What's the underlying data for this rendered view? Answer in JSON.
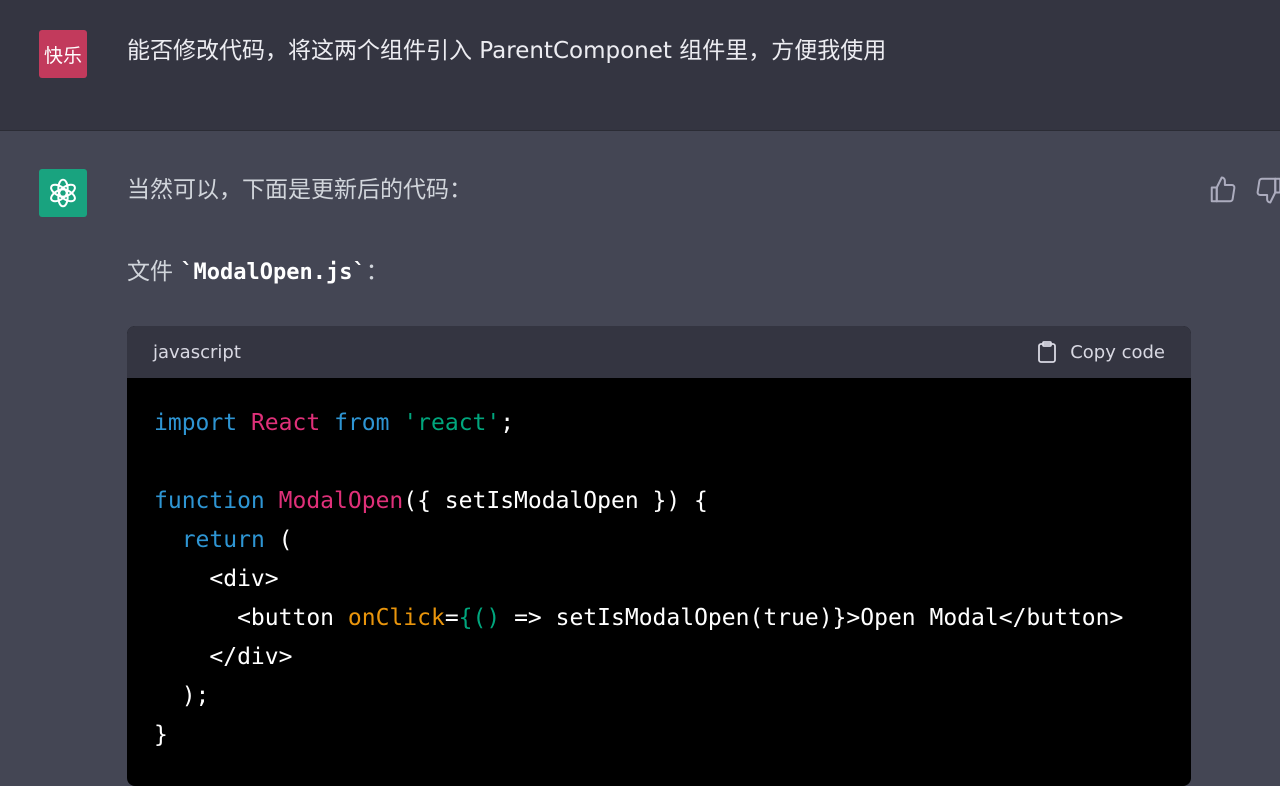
{
  "user_message": {
    "avatar_text": "快乐",
    "text": "能否修改代码，将这两个组件引入 ParentComponet  组件里，方便我使用"
  },
  "assistant_message": {
    "intro": "当然可以，下面是更新后的代码：",
    "file_label_prefix": "文件 ",
    "file_name": "`ModalOpen.js`",
    "file_label_suffix": "：",
    "code_block": {
      "language": "javascript",
      "copy_label": "Copy code",
      "lines": [
        [
          {
            "t": "import",
            "c": "keyword"
          },
          {
            "t": " "
          },
          {
            "t": "React",
            "c": "class"
          },
          {
            "t": " "
          },
          {
            "t": "from",
            "c": "keyword"
          },
          {
            "t": " "
          },
          {
            "t": "'react'",
            "c": "string"
          },
          {
            "t": ";"
          }
        ],
        [],
        [
          {
            "t": "function",
            "c": "keyword"
          },
          {
            "t": " "
          },
          {
            "t": "ModalOpen",
            "c": "class"
          },
          {
            "t": "({ setIsModalOpen }) {"
          }
        ],
        [
          {
            "t": "  "
          },
          {
            "t": "return",
            "c": "keyword"
          },
          {
            "t": " ("
          }
        ],
        [
          {
            "t": "    <div>"
          }
        ],
        [
          {
            "t": "      <button "
          },
          {
            "t": "onClick",
            "c": "attr"
          },
          {
            "t": "="
          },
          {
            "t": "{()",
            "c": "string"
          },
          {
            "t": " => setIsModalOpen(true)}>Open Modal</button>"
          }
        ],
        [
          {
            "t": "    </div>"
          }
        ],
        [
          {
            "t": "  );"
          }
        ],
        [
          {
            "t": "}"
          }
        ]
      ]
    }
  },
  "colors": {
    "user_bg": "#343541",
    "assistant_bg": "#444654",
    "user_avatar": "#c23a5c",
    "assistant_avatar": "#19a37f"
  },
  "icons": [
    "openai-logo-icon",
    "thumbs-up-icon",
    "thumbs-down-icon",
    "clipboard-icon"
  ]
}
